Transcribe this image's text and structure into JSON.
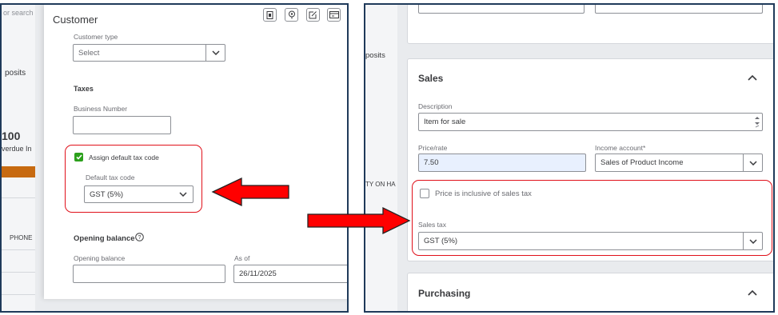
{
  "left": {
    "search_fragment": "or search",
    "deposits_fragment": "posits",
    "amount_fragment": "100",
    "overdue_fragment": "verdue In",
    "phone_fragment": "PHONE",
    "title": "Customer",
    "customer_type": {
      "label": "Customer type",
      "placeholder": "Select"
    },
    "taxes_heading": "Taxes",
    "business_number_label": "Business Number",
    "assign_default_tax_code": {
      "label": "Assign default tax code",
      "checked": true
    },
    "default_tax_code": {
      "label": "Default tax code",
      "value": "GST (5%)"
    },
    "opening_balance_heading": "Opening balance",
    "opening_balance_label": "Opening balance",
    "as_of_label": "As of",
    "as_of_value": "26/11/2025"
  },
  "right": {
    "deposits_fragment": "posits",
    "qty_fragment": "TY ON HA",
    "sales": {
      "title": "Sales",
      "description_label": "Description",
      "description_value": "Item for sale",
      "price_label": "Price/rate",
      "price_value": "7.50",
      "income_account_label": "Income account*",
      "income_account_value": "Sales of Product Income",
      "inclusive_label": "Price is inclusive of sales tax",
      "inclusive_checked": false,
      "sales_tax_label": "Sales tax",
      "sales_tax_value": "GST (5%)"
    },
    "purchasing_title": "Purchasing"
  },
  "colors": {
    "accent_green": "#2ca01c",
    "highlight_red": "#e0101a",
    "arrow_red": "#ff0000",
    "progress_orange": "#c76a10"
  }
}
